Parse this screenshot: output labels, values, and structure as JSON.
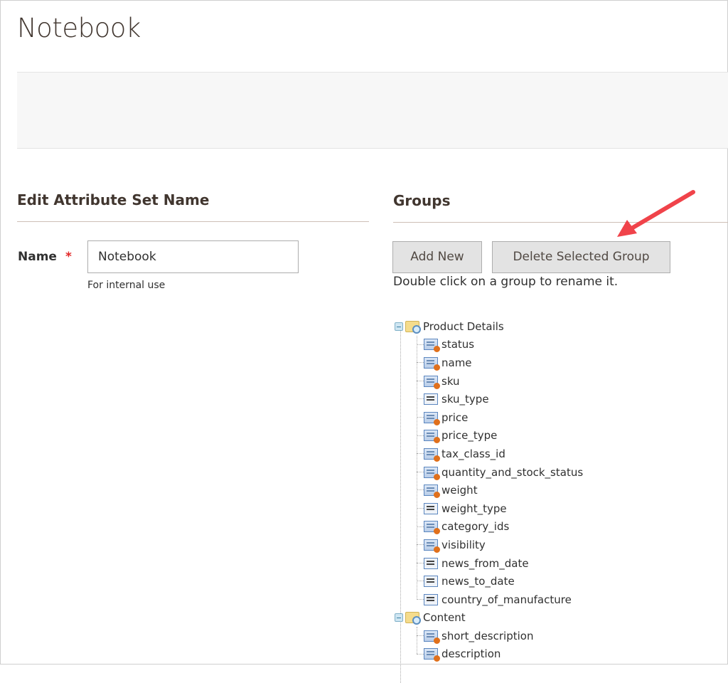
{
  "page": {
    "title": "Notebook"
  },
  "edit_section": {
    "title": "Edit Attribute Set Name",
    "name_label": "Name",
    "required_mark": "*",
    "name_value": "Notebook",
    "name_note": "For internal use"
  },
  "groups_section": {
    "title": "Groups",
    "add_new_label": "Add New",
    "delete_label": "Delete Selected Group",
    "hint": "Double click on a group to rename it."
  },
  "tree": [
    {
      "label": "Product Details",
      "icon": "folder-icon",
      "children": [
        {
          "label": "status",
          "icon": "system-attribute-icon"
        },
        {
          "label": "name",
          "icon": "system-attribute-icon"
        },
        {
          "label": "sku",
          "icon": "system-attribute-icon"
        },
        {
          "label": "sku_type",
          "icon": "attribute-icon"
        },
        {
          "label": "price",
          "icon": "system-attribute-icon"
        },
        {
          "label": "price_type",
          "icon": "system-attribute-icon"
        },
        {
          "label": "tax_class_id",
          "icon": "system-attribute-icon"
        },
        {
          "label": "quantity_and_stock_status",
          "icon": "system-attribute-icon"
        },
        {
          "label": "weight",
          "icon": "system-attribute-icon"
        },
        {
          "label": "weight_type",
          "icon": "attribute-icon"
        },
        {
          "label": "category_ids",
          "icon": "system-attribute-icon"
        },
        {
          "label": "visibility",
          "icon": "system-attribute-icon"
        },
        {
          "label": "news_from_date",
          "icon": "attribute-icon"
        },
        {
          "label": "news_to_date",
          "icon": "attribute-icon"
        },
        {
          "label": "country_of_manufacture",
          "icon": "attribute-icon"
        }
      ]
    },
    {
      "label": "Content",
      "icon": "folder-icon",
      "children": [
        {
          "label": "short_description",
          "icon": "system-attribute-icon"
        },
        {
          "label": "description",
          "icon": "system-attribute-icon"
        }
      ]
    }
  ],
  "colors": {
    "arrow": "#f0434a",
    "required": "#e22626",
    "button_bg": "#e3e3e3"
  }
}
